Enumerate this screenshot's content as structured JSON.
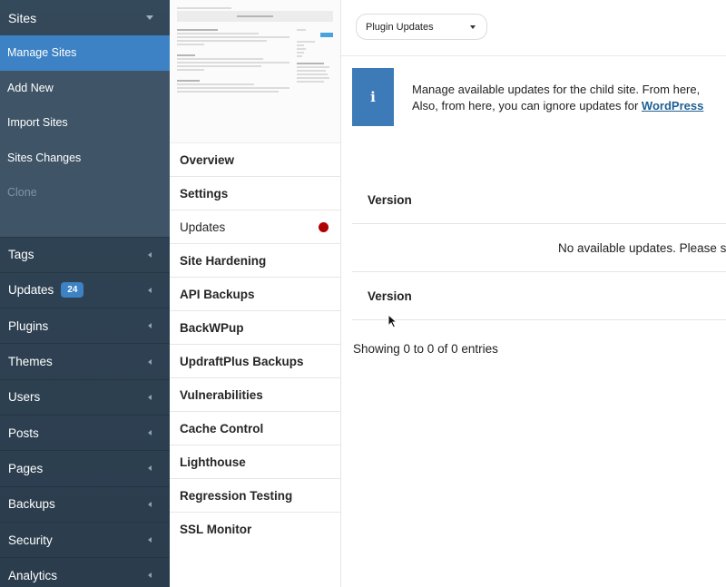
{
  "sidebar": {
    "top_label": "Sites",
    "sub_items": [
      {
        "label": "Manage Sites"
      },
      {
        "label": "Add New"
      },
      {
        "label": "Import Sites"
      },
      {
        "label": "Sites Changes"
      },
      {
        "label": "Clone"
      }
    ],
    "items": [
      {
        "label": "Tags"
      },
      {
        "label": "Updates",
        "badge": "24"
      },
      {
        "label": "Plugins"
      },
      {
        "label": "Themes"
      },
      {
        "label": "Users"
      },
      {
        "label": "Posts"
      },
      {
        "label": "Pages"
      },
      {
        "label": "Backups"
      },
      {
        "label": "Security"
      },
      {
        "label": "Analytics"
      }
    ]
  },
  "site_menu": {
    "items": [
      {
        "label": "Overview"
      },
      {
        "label": "Settings"
      },
      {
        "label": "Updates"
      },
      {
        "label": "Site Hardening"
      },
      {
        "label": "API Backups"
      },
      {
        "label": "BackWPup"
      },
      {
        "label": "UpdraftPlus Backups"
      },
      {
        "label": "Vulnerabilities"
      },
      {
        "label": "Cache Control"
      },
      {
        "label": "Lighthouse"
      },
      {
        "label": "Regression Testing"
      },
      {
        "label": "SSL Monitor"
      }
    ]
  },
  "main": {
    "dropdown_value": "Plugin Updates",
    "notice": {
      "line1": "Manage available updates for the child site. From here,",
      "line2_prefix": "Also, from here, you can ignore updates for ",
      "line2_link": "WordPress"
    },
    "table": {
      "header_top": "Version",
      "empty_message": "No available updates. Please s",
      "header_bottom": "Version"
    },
    "showing": "Showing 0 to 0 of 0 entries"
  },
  "colors": {
    "sidebar_bg": "#2f4253",
    "active_blue": "#3c82c4",
    "info_blue": "#3d7ab8",
    "link": "#1d5f93",
    "dot_red": "#b00000"
  }
}
